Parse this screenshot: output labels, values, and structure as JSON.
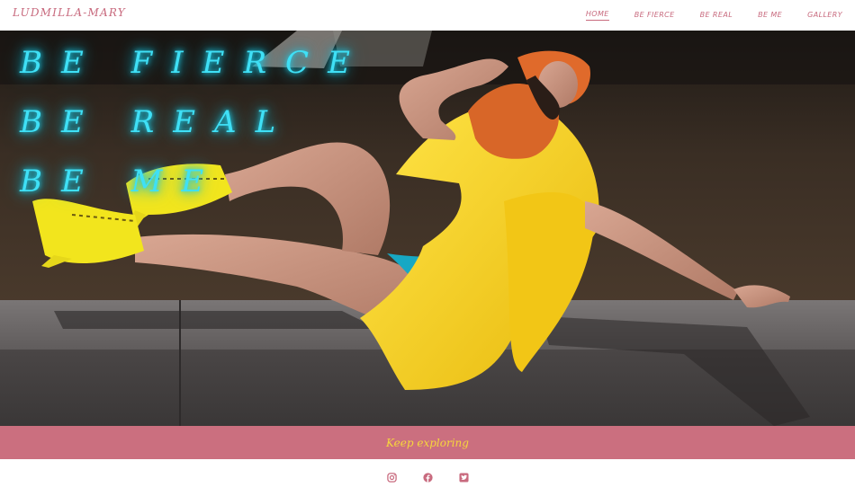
{
  "header": {
    "logo": "LUDMILLA-MARY",
    "nav": [
      {
        "label": "HOME",
        "active": true
      },
      {
        "label": "BE FIERCE",
        "active": false
      },
      {
        "label": "BE REAL",
        "active": false
      },
      {
        "label": "BE ME",
        "active": false
      },
      {
        "label": "GALLERY",
        "active": false
      }
    ]
  },
  "hero": {
    "lines": [
      "BE FIERCE",
      "BE REAL",
      "BE ME"
    ],
    "neon_color": "#3fe0f6"
  },
  "banner": {
    "label": "Keep exploring",
    "background": "#cb6f7f",
    "text_color": "#f7d63c"
  },
  "footer": {
    "social": [
      {
        "icon": "instagram-icon"
      },
      {
        "icon": "facebook-icon"
      },
      {
        "icon": "twitter-icon"
      }
    ],
    "icon_color": "#c86a7e"
  }
}
